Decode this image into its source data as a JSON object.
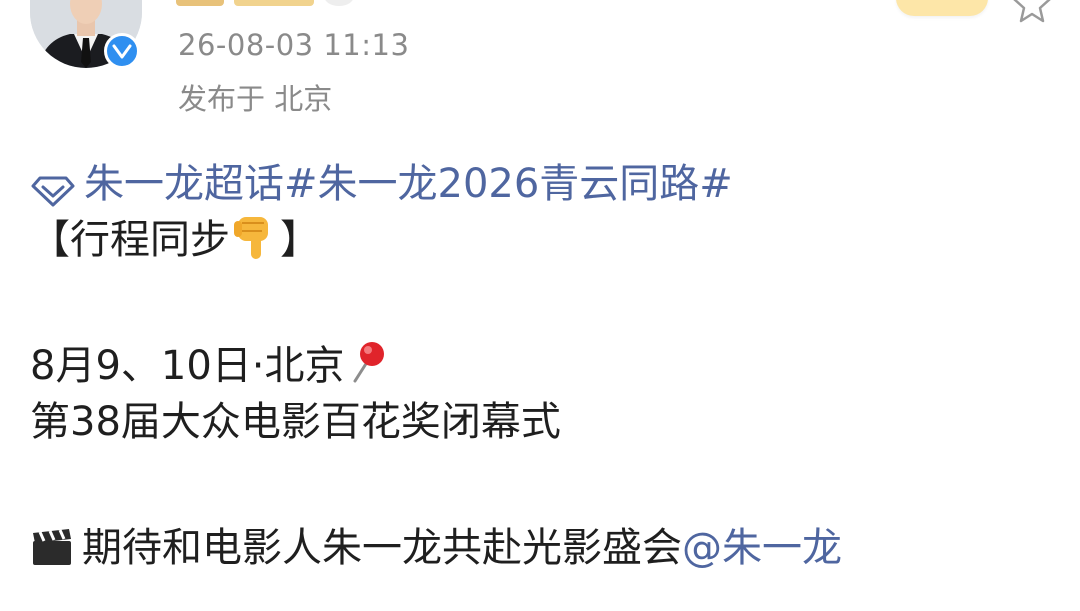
{
  "header": {
    "timestamp": "26-08-03 11:13",
    "location": "发布于 北京"
  },
  "post": {
    "supertopic": "朱一龙超话",
    "hashtag": "#朱一龙2026青云同路#",
    "schedule_open": "【行程同步",
    "schedule_close": "】",
    "date_place": "8月9、10日·北京",
    "event": "第38届大众电影百花奖闭幕式",
    "cheer_text": "期待和电影人朱一龙共赴光影盛会",
    "mention": "@朱一龙"
  },
  "colors": {
    "link": "#4f66a0",
    "meta": "#8a8a8a",
    "verified": "#2f8ff0"
  },
  "icons": [
    "avatar",
    "verified-icon",
    "star-icon",
    "diamond-icon",
    "pointing-down-hand-icon",
    "pushpin-icon",
    "clapperboard-icon"
  ]
}
